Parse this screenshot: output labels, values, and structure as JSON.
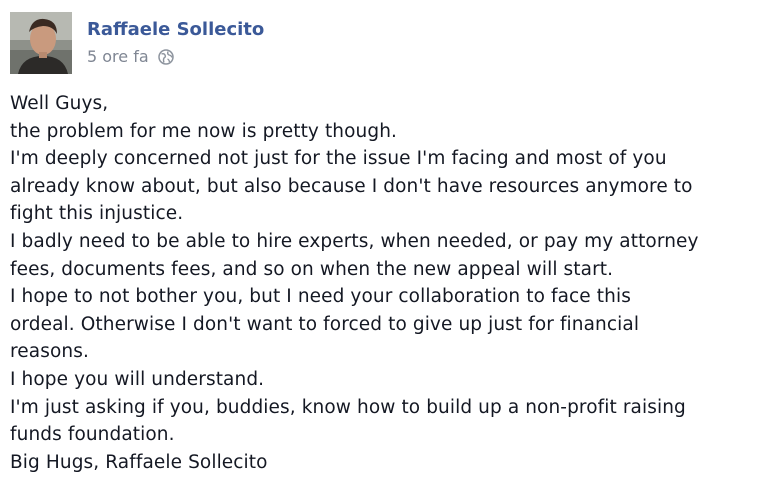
{
  "post": {
    "author": "Raffaele Sollecito",
    "timestamp": "5 ore fa",
    "privacy_icon": "globe-icon",
    "avatar_icon": "profile-photo",
    "lines": [
      "Well Guys,",
      "the problem for me now is pretty though.",
      "I'm deeply concerned not just for the issue I'm facing and most of you",
      "already know about, but also because I don't have resources anymore to",
      "fight this injustice.",
      "I badly need to be able to hire experts, when needed, or pay my attorney",
      "fees, documents fees, and so on when the new appeal will start.",
      "I hope to not bother you, but I need your collaboration to face this",
      "ordeal. Otherwise I don't want to forced to give up just for financial",
      "reasons.",
      "I hope you will understand.",
      "I'm just asking if you, buddies, know how to build up a non-profit raising",
      "funds foundation.",
      "Big Hugs, Raffaele Sollecito"
    ]
  },
  "colors": {
    "author_link": "#3b5998",
    "meta_text": "#7f8693",
    "body_text": "#141823"
  }
}
